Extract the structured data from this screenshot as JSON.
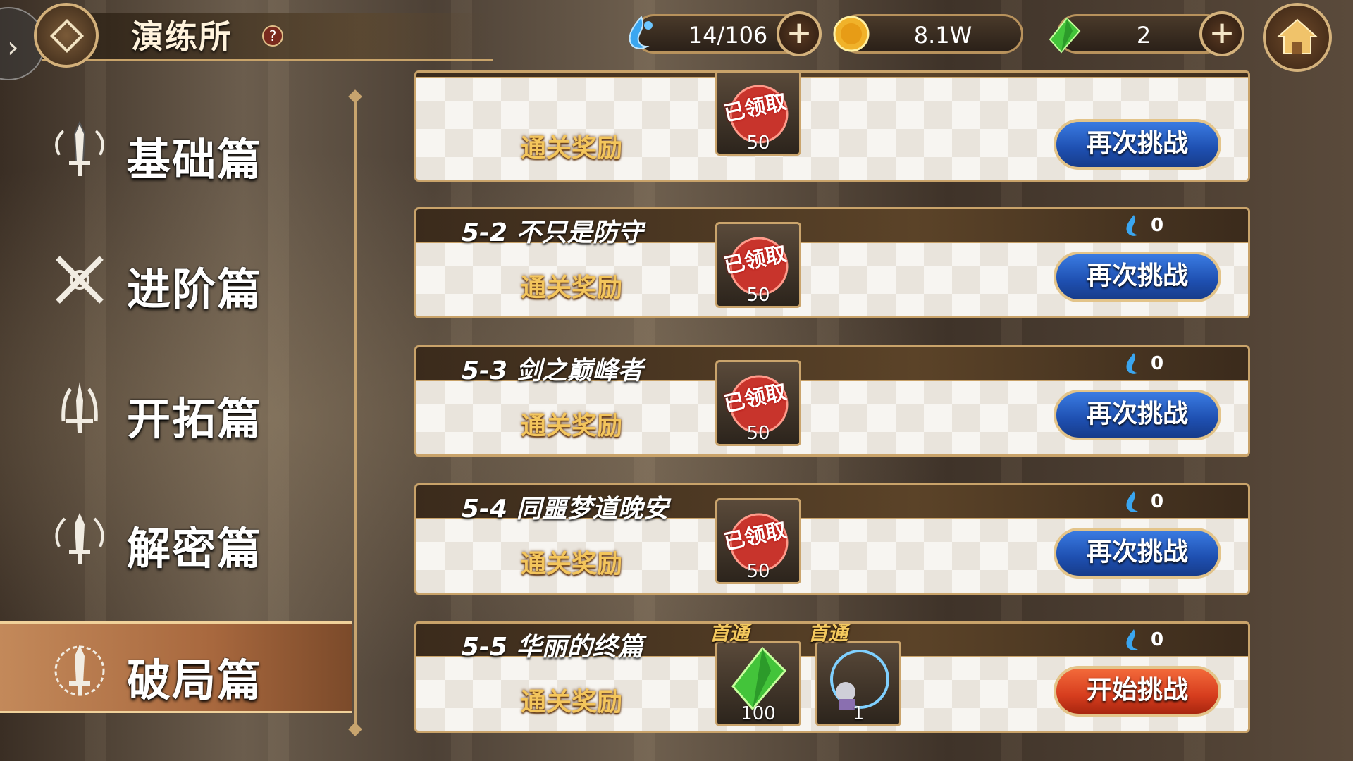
{
  "header": {
    "title": "演练所",
    "help_label": "?",
    "stamina": "14/106",
    "coins": "8.1W",
    "gems": "2",
    "plus_label": "+"
  },
  "sidebar": {
    "items": [
      {
        "label": "基础篇",
        "active": false
      },
      {
        "label": "进阶篇",
        "active": false
      },
      {
        "label": "开拓篇",
        "active": false
      },
      {
        "label": "解密篇",
        "active": false
      },
      {
        "label": "破局篇",
        "active": true
      }
    ]
  },
  "stages": [
    {
      "title": "",
      "cost": "",
      "reward_label": "通关奖励",
      "claimed_label": "已领取",
      "reward_count": "50",
      "button": "再次挑战"
    },
    {
      "title": "5-2 不只是防守",
      "cost": "0",
      "reward_label": "通关奖励",
      "claimed_label": "已领取",
      "reward_count": "50",
      "button": "再次挑战"
    },
    {
      "title": "5-3 剑之巅峰者",
      "cost": "0",
      "reward_label": "通关奖励",
      "claimed_label": "已领取",
      "reward_count": "50",
      "button": "再次挑战"
    },
    {
      "title": "5-4 同噩梦道晚安",
      "cost": "0",
      "reward_label": "通关奖励",
      "claimed_label": "已领取",
      "reward_count": "50",
      "button": "再次挑战"
    },
    {
      "title": "5-5 华丽的终篇",
      "cost": "0",
      "reward_label": "通关奖励",
      "first_clear_label": "首通",
      "rewards": [
        {
          "count": "100",
          "icon": "green-crystal-icon"
        },
        {
          "count": "1",
          "icon": "character-frame-icon"
        }
      ],
      "button": "开始挑战"
    }
  ],
  "colors": {
    "accent_gold": "#c9a36a",
    "button_blue": "#1e4fb0",
    "button_red": "#d63d1e"
  }
}
